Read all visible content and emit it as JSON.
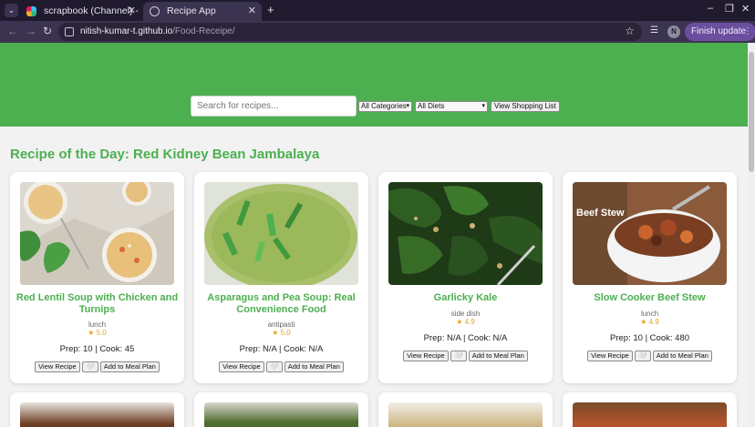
{
  "browser": {
    "tabs": [
      {
        "title": "scrapbook (Channel) - Ha",
        "active": false
      },
      {
        "title": "Recipe App",
        "active": true
      }
    ],
    "url_host": "nitish-kumar-t.github.io",
    "url_path": "/Food-Receipe/",
    "avatar_letter": "N",
    "update_label": "Finish update"
  },
  "header": {
    "search_placeholder": "Search for recipes...",
    "category_select": "All Categories",
    "diet_select": "All Diets",
    "shopping_button": "View Shopping List"
  },
  "recipe_of_day": "Recipe of the Day: Red Kidney Bean Jambalaya",
  "labels": {
    "view_recipe": "View Recipe",
    "favorite": "🤍",
    "add_meal": "Add to Meal Plan"
  },
  "cards": [
    {
      "title": "Red Lentil Soup with Chicken and Turnips",
      "category": "lunch",
      "rating": "★ 5.0",
      "times": "Prep: 10 | Cook: 45"
    },
    {
      "title": "Asparagus and Pea Soup: Real Convenience Food",
      "category": "antipasti",
      "rating": "★ 5.0",
      "times": "Prep: N/A | Cook: N/A"
    },
    {
      "title": "Garlicky Kale",
      "category": "side dish",
      "rating": "★ 4.9",
      "times": "Prep: N/A | Cook: N/A"
    },
    {
      "title": "Slow Cooker Beef Stew",
      "category": "lunch",
      "rating": "★ 4.9",
      "times": "Prep: 10 | Cook: 480"
    }
  ],
  "image_overlays": {
    "beef_stew_text": "Beef Stew"
  },
  "colors": {
    "accent": "#4caf50",
    "rating": "#e9a21b"
  }
}
